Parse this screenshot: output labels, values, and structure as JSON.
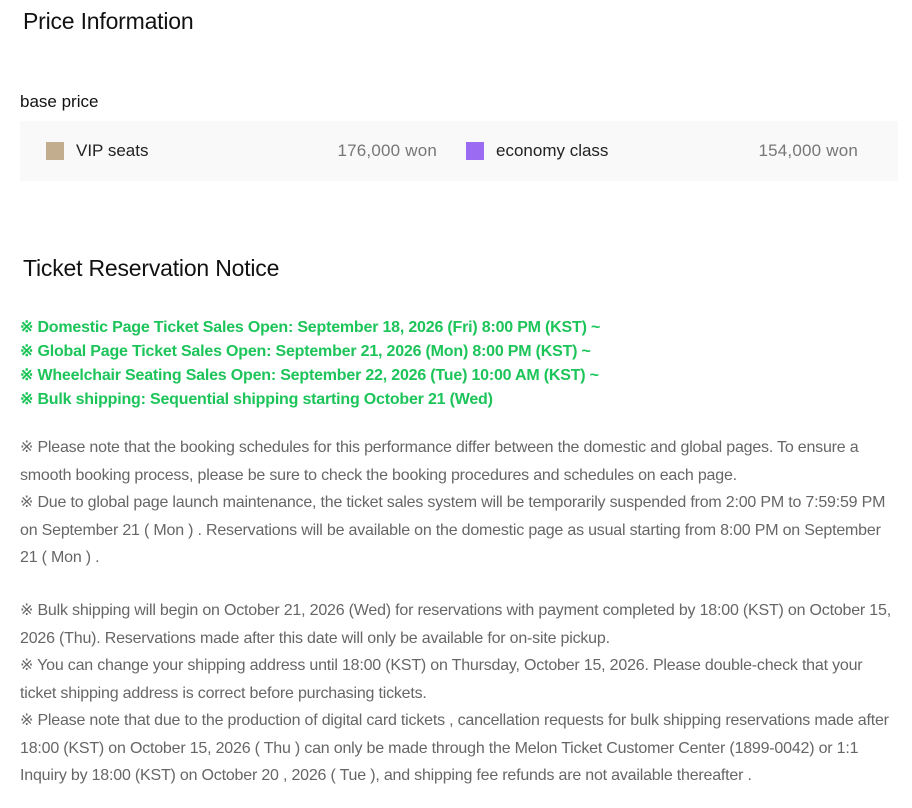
{
  "price_info": {
    "title": "Price Information",
    "base_price_label": "base price",
    "seats": [
      {
        "name": "VIP seats",
        "price": "176,000 won",
        "color": "#c2ad8f"
      },
      {
        "name": "economy class",
        "price": "154,000 won",
        "color": "#9b6bf2"
      }
    ]
  },
  "notice": {
    "title": "Ticket Reservation Notice",
    "highlights": [
      "※ Domestic Page Ticket Sales Open: September 18, 2026 (Fri) 8:00 PM (KST) ~",
      "※ Global Page Ticket Sales Open: September 21, 2026 (Mon) 8:00 PM (KST) ~",
      "※ Wheelchair Seating Sales Open: September 22, 2026 (Tue) 10:00 AM (KST) ~",
      "※ Bulk shipping: Sequential shipping starting October 21 (Wed)"
    ],
    "highlight_color": "#1dc45a",
    "paragraphs_1": [
      "※ Please note that the booking schedules for this performance differ between the domestic and global pages. To ensure a smooth booking process, please be sure to check the booking procedures and schedules on each page.",
      "※ Due to global page launch maintenance, the ticket sales system will be temporarily suspended from 2:00 PM to 7:59:59 PM on September 21 ( Mon ) . Reservations will be available on the domestic page as usual starting from 8:00 PM on September 21 ( Mon ) ."
    ],
    "paragraphs_2": [
      "※ Bulk shipping will begin on October 21, 2026 (Wed) for reservations with payment completed by 18:00 (KST) on October 15, 2026 (Thu). Reservations made after this date will only be available for on-site pickup.",
      "※ You can change your shipping address until 18:00 (KST) on Thursday, October 15, 2026. Please double-check that your ticket shipping address is correct before purchasing tickets.",
      "※ Please note that due to the production of digital card tickets , cancellation requests for bulk shipping reservations made after 18:00 (KST) on October 15, 2026 ( Thu ) can only be made through the Melon Ticket Customer Center (1899-0042) or 1:1 Inquiry by 18:00 (KST) on October 20 , 2026 ( Tue ), and shipping fee refunds are not available thereafter ."
    ]
  }
}
